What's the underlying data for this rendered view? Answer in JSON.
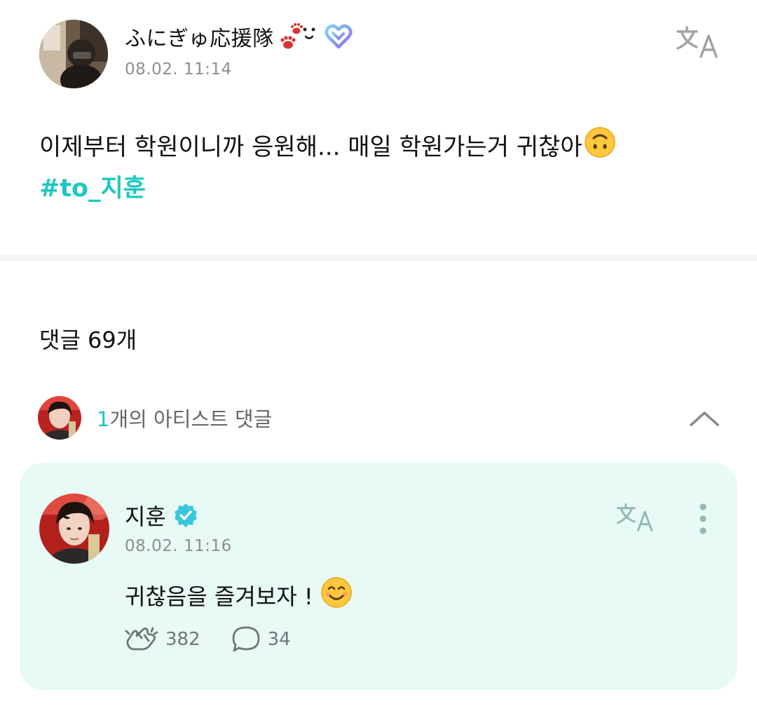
{
  "post": {
    "author": "ふにぎゅ応援隊",
    "time": "08.02. 11:14",
    "text": "이제부터 학원이니까 응원해... 매일 학원가는거 귀찮아",
    "hashtag": "#to_지훈",
    "translate_icon": "translate-icon"
  },
  "comments": {
    "count_label": "댓글 69개",
    "artist_row": {
      "count": "1",
      "label": "개의 아티스트 댓글",
      "toggle_icon": "chevron-up-icon"
    },
    "artist_comment": {
      "author": "지훈",
      "verified_icon": "verified-badge-icon",
      "time": "08.02. 11:16",
      "text": "귀찮음을 즐겨보자 !",
      "likes": "382",
      "replies": "34"
    }
  },
  "colors": {
    "accent": "#1fc7c0",
    "card_bg": "#e7faf6",
    "muted": "#8e8e8e"
  }
}
